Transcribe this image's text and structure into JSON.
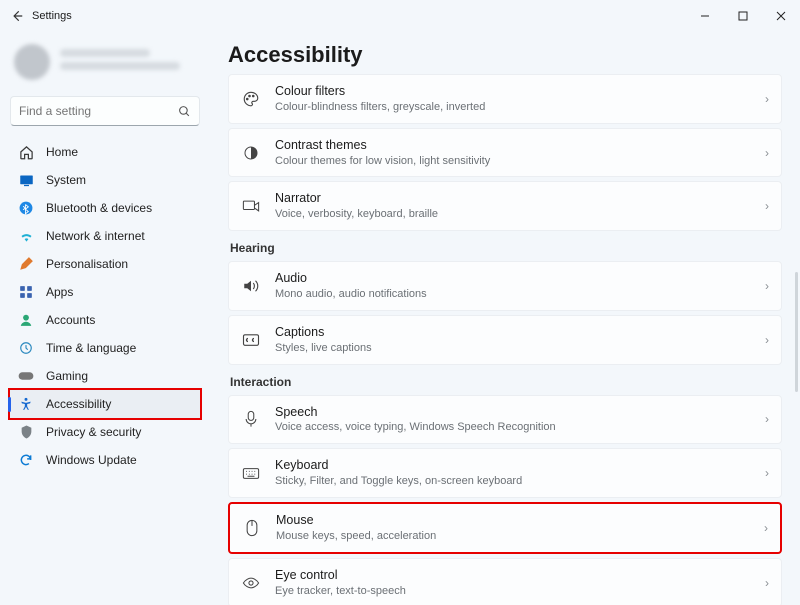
{
  "window": {
    "title": "Settings"
  },
  "search": {
    "placeholder": "Find a setting"
  },
  "sidebar": {
    "items": [
      {
        "label": "Home"
      },
      {
        "label": "System"
      },
      {
        "label": "Bluetooth & devices"
      },
      {
        "label": "Network & internet"
      },
      {
        "label": "Personalisation"
      },
      {
        "label": "Apps"
      },
      {
        "label": "Accounts"
      },
      {
        "label": "Time & language"
      },
      {
        "label": "Gaming"
      },
      {
        "label": "Accessibility"
      },
      {
        "label": "Privacy & security"
      },
      {
        "label": "Windows Update"
      }
    ]
  },
  "page": {
    "heading": "Accessibility"
  },
  "sections": {
    "hearing_label": "Hearing",
    "interaction_label": "Interaction"
  },
  "cards": {
    "colour_filters": {
      "title": "Colour filters",
      "desc": "Colour-blindness filters, greyscale, inverted"
    },
    "contrast": {
      "title": "Contrast themes",
      "desc": "Colour themes for low vision, light sensitivity"
    },
    "narrator": {
      "title": "Narrator",
      "desc": "Voice, verbosity, keyboard, braille"
    },
    "audio": {
      "title": "Audio",
      "desc": "Mono audio, audio notifications"
    },
    "captions": {
      "title": "Captions",
      "desc": "Styles, live captions"
    },
    "speech": {
      "title": "Speech",
      "desc": "Voice access, voice typing, Windows Speech Recognition"
    },
    "keyboard": {
      "title": "Keyboard",
      "desc": "Sticky, Filter, and Toggle keys, on-screen keyboard"
    },
    "mouse": {
      "title": "Mouse",
      "desc": "Mouse keys, speed, acceleration"
    },
    "eye": {
      "title": "Eye control",
      "desc": "Eye tracker, text-to-speech"
    }
  }
}
